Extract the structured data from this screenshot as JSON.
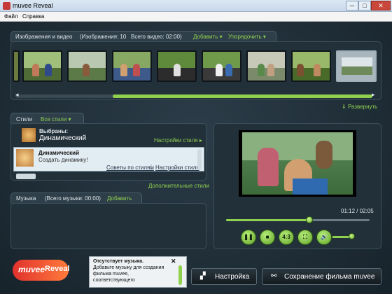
{
  "window": {
    "title": "muvee Reveal",
    "minimize": "─",
    "maximize": "□",
    "close": "✕"
  },
  "menu": {
    "file": "Файл",
    "help": "Справка"
  },
  "media": {
    "tab_label": "Изображения и видео",
    "stats": "(Изображения: 10",
    "video_total": "Всего видео: 02:00)",
    "add_label": "Добавить",
    "sort_label": "Упорядочить",
    "expand_label": "Развернуть"
  },
  "styles": {
    "tab_label": "Стили",
    "all_styles": "Все стили",
    "selected_caption": "Выбраны:",
    "selected_name": "Динамический",
    "settings_link": "Настройки стиля",
    "item_title": "Динамический",
    "item_subtitle": "Создать динамику!",
    "tips_link": "Советы по стилям",
    "item_settings_link": "Настройки стиля",
    "additional_link": "Дополнительные стили"
  },
  "music": {
    "tab_label": "Музыка",
    "total": "(Всего музыки: 00:00)",
    "add_label": "Добавить"
  },
  "preview": {
    "time_readout": "01:12 / 02:05",
    "progress": 0.58,
    "volume": 0.9
  },
  "controls": {
    "play_icon": "play-icon",
    "stop_icon": "stop-icon",
    "aspect_label": "4:3",
    "fullscreen_icon": "fullscreen-icon",
    "volume_icon": "volume-icon"
  },
  "notice": {
    "title": "Отсутствует музыка.",
    "body_line1": "Добавьте музыку для создания",
    "body_line2": "фильма muvee,",
    "body_line3": "соответствующего"
  },
  "brand": {
    "muvee": "muvee",
    "reveal": "Reveal"
  },
  "actions": {
    "settings_label": "Настройка",
    "save_label": "Сохранение фильма muvee"
  },
  "colors": {
    "accent": "#8fd14f",
    "background": "#1d2a33"
  }
}
